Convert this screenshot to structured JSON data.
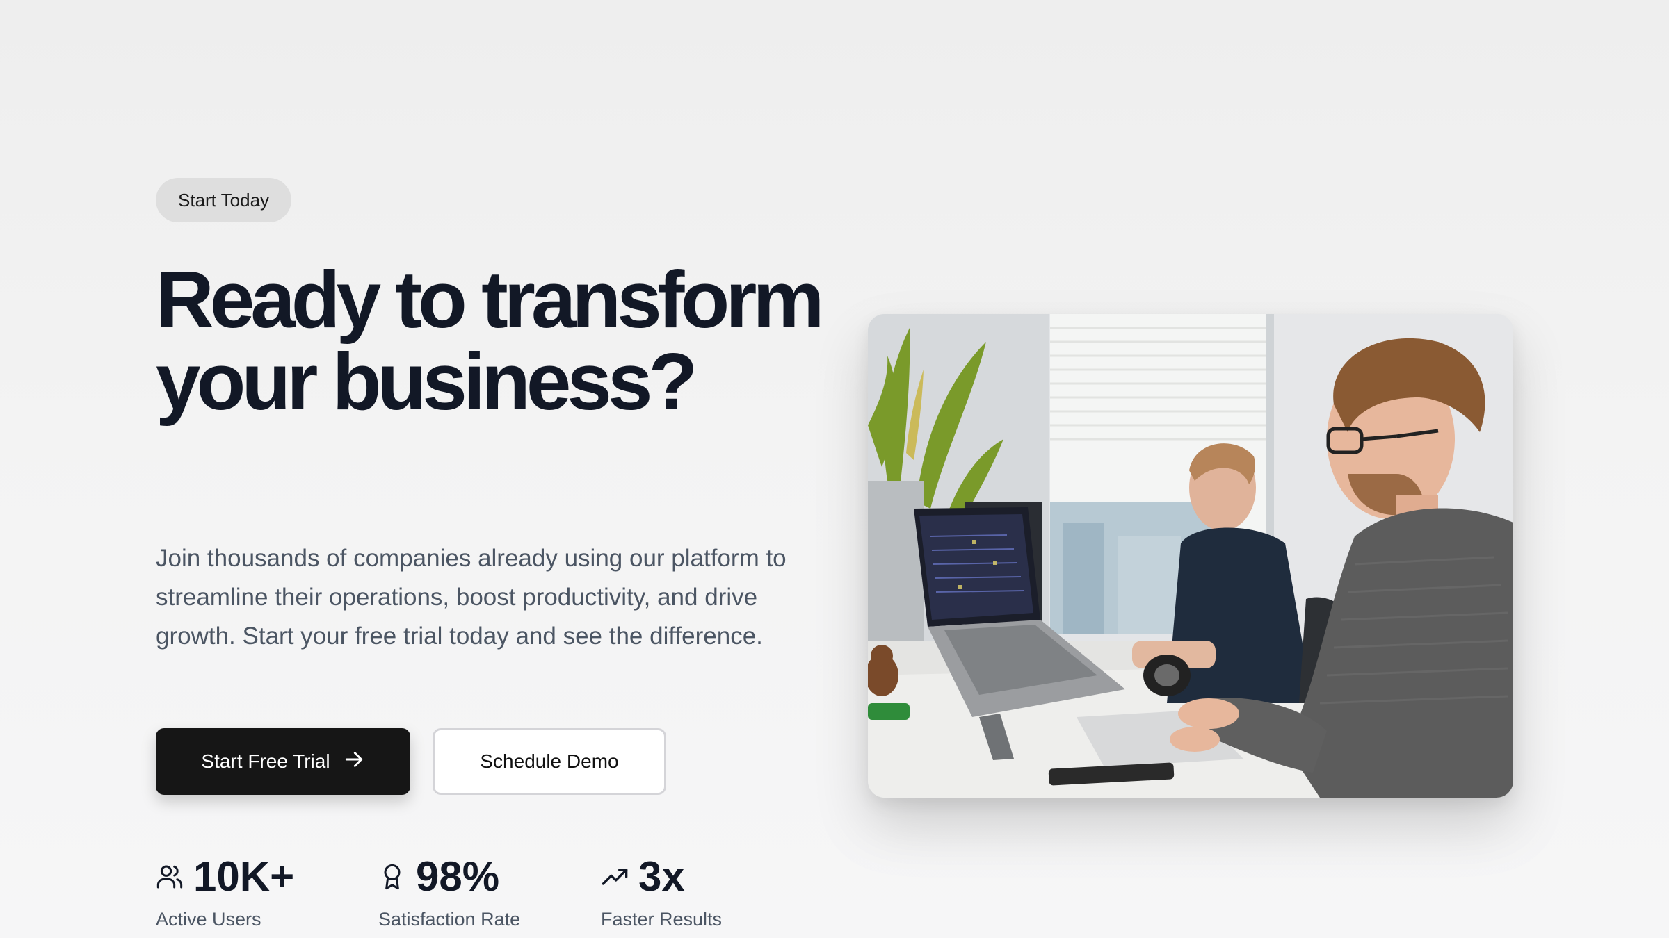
{
  "hero": {
    "badge": "Start Today",
    "headline": "Ready to transform your business?",
    "description": "Join thousands of companies already using our platform to streamline their operations, boost productivity, and drive growth. Start your free trial today and see the difference.",
    "primary_cta": "Start Free Trial",
    "primary_cta_icon": "arrow-right-icon",
    "secondary_cta": "Schedule Demo"
  },
  "stats": [
    {
      "icon": "users-icon",
      "value": "10K+",
      "label": "Active Users"
    },
    {
      "icon": "award-icon",
      "value": "98%",
      "label": "Satisfaction Rate"
    },
    {
      "icon": "trending-up-icon",
      "value": "3x",
      "label": "Faster Results"
    }
  ],
  "image": {
    "subject": "two men working at laptops in a bright office",
    "colors": {
      "wall": "#dfe3e6",
      "sweater_gray": "#5a5a5a",
      "sweater_navy": "#1f2c3d",
      "plant": "#7a9a2a"
    }
  },
  "colors": {
    "heading": "#121826",
    "body": "#4b5563",
    "primary_button": "#161616",
    "badge_bg": "#dedede"
  }
}
